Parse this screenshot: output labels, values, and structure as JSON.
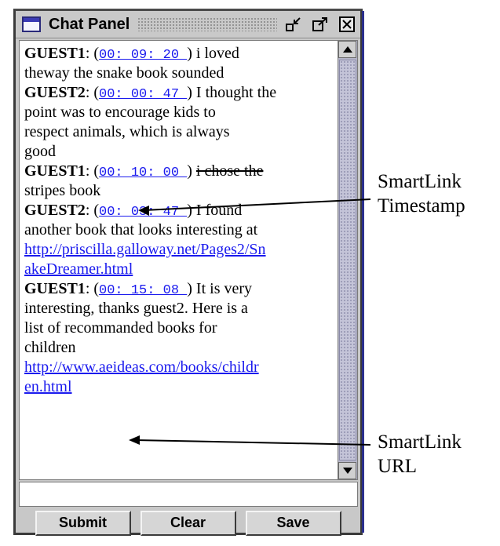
{
  "window": {
    "title": "Chat Panel",
    "icons": [
      "app-window-icon",
      "minimize-icon",
      "maximize-icon",
      "close-icon"
    ]
  },
  "chat": {
    "messages": [
      {
        "sender": "GUEST1",
        "timestamp": "00: 09: 20 ",
        "text": [
          "i loved",
          "theway the snake book sounded"
        ]
      },
      {
        "sender": "GUEST2",
        "timestamp": "00: 00: 47 ",
        "text": [
          "I thought the",
          "point was to encourage kids to",
          "respect animals, which is always",
          "good"
        ]
      },
      {
        "sender": "GUEST1",
        "timestamp": "00: 10: 00 ",
        "text": [
          "i chose the",
          "stripes book"
        ]
      },
      {
        "sender": "GUEST2",
        "timestamp": "00: 03: 47 ",
        "text": [
          "I found",
          "another book that looks interesting at"
        ],
        "url": [
          "http://priscilla.galloway.net/Pages2/Sn",
          "akeDreamer.html "
        ]
      },
      {
        "sender": "GUEST1",
        "timestamp": "00: 15: 08 ",
        "text": [
          "It is very",
          "interesting, thanks guest2. Here is a",
          "list of recommanded books for",
          "children"
        ],
        "url": [
          "http://www.aeideas.com/books/childr",
          "en.html "
        ]
      }
    ]
  },
  "input": {
    "value": ""
  },
  "buttons": {
    "submit": "Submit",
    "clear": "Clear",
    "save": "Save"
  },
  "callouts": {
    "timestamp": [
      "SmartLink",
      "Timestamp"
    ],
    "url": [
      "SmartLink",
      "URL"
    ]
  },
  "colors": {
    "link": "#1a1aee",
    "title_icon": "#3b3bb5",
    "scrollbar": "#b5b5c8"
  }
}
